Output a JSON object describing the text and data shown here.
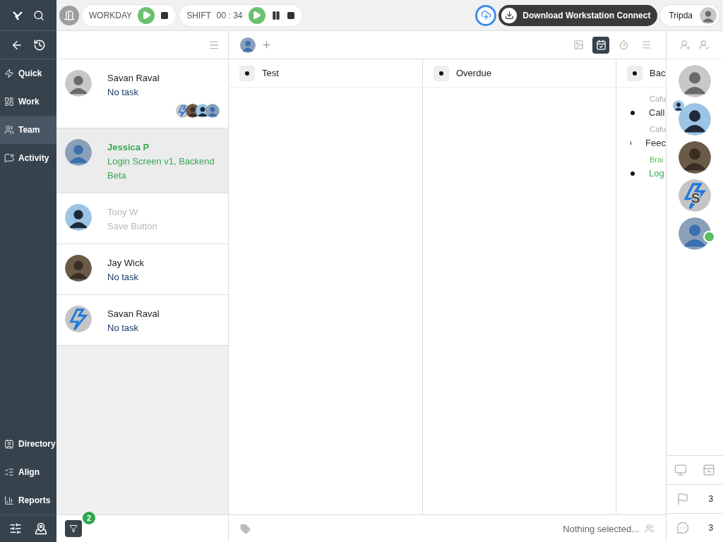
{
  "topbar": {
    "workday": {
      "label": "WORKDAY",
      "running": false
    },
    "shift": {
      "label": "SHIFT",
      "time": "00 : 34",
      "running": false
    },
    "download": "Download Workstation Connect",
    "user": "Tripda"
  },
  "sidebar": {
    "items": [
      {
        "label": "Quick",
        "selected": false
      },
      {
        "label": "Work",
        "selected": false
      },
      {
        "label": "Team",
        "selected": true
      },
      {
        "label": "Activity",
        "selected": false
      }
    ],
    "bottom_items": [
      {
        "label": "Directory",
        "selected": false
      },
      {
        "label": "Align",
        "selected": false
      },
      {
        "label": "Reports",
        "selected": false
      }
    ]
  },
  "team": {
    "members": [
      {
        "name": "Savan Raval",
        "task": "No task",
        "selected": false,
        "active": false,
        "disabled": false,
        "watchers": true
      },
      {
        "name": "Jessica P",
        "task": "Login Screen v1, Backend Beta",
        "selected": true,
        "active": true,
        "disabled": false,
        "watchers": false
      },
      {
        "name": "Tony W",
        "task": "Save Button",
        "selected": false,
        "active": false,
        "disabled": true,
        "watchers": false
      },
      {
        "name": "Jay Wick",
        "task": "No task",
        "selected": false,
        "active": false,
        "disabled": false,
        "watchers": false
      },
      {
        "name": "Savan Raval",
        "task": "No task",
        "selected": false,
        "active": false,
        "disabled": false,
        "watchers": false
      }
    ],
    "filter_count": "2"
  },
  "board": {
    "views": [
      {
        "selected": false
      },
      {
        "selected": true
      },
      {
        "selected": false
      },
      {
        "selected": false
      }
    ],
    "columns": [
      {
        "title": "Test"
      },
      {
        "title": "Overdue"
      },
      {
        "title": "Bac",
        "tasks": [
          {
            "project": "Cafu",
            "title": "Call",
            "active": false
          },
          {
            "project": "Cafu",
            "title": "Feec",
            "active": false
          },
          {
            "project": "Brai",
            "title": "Log",
            "active": true
          }
        ]
      }
    ],
    "status": "Nothing selected..."
  },
  "rail": {
    "avatars": [
      {
        "online": false,
        "badge": false
      },
      {
        "online": false,
        "badge": true
      },
      {
        "online": false,
        "badge": false
      },
      {
        "online": false,
        "badge": false,
        "initial": "S"
      },
      {
        "online": true,
        "badge": false
      }
    ],
    "flags": "3",
    "comments": "3"
  }
}
